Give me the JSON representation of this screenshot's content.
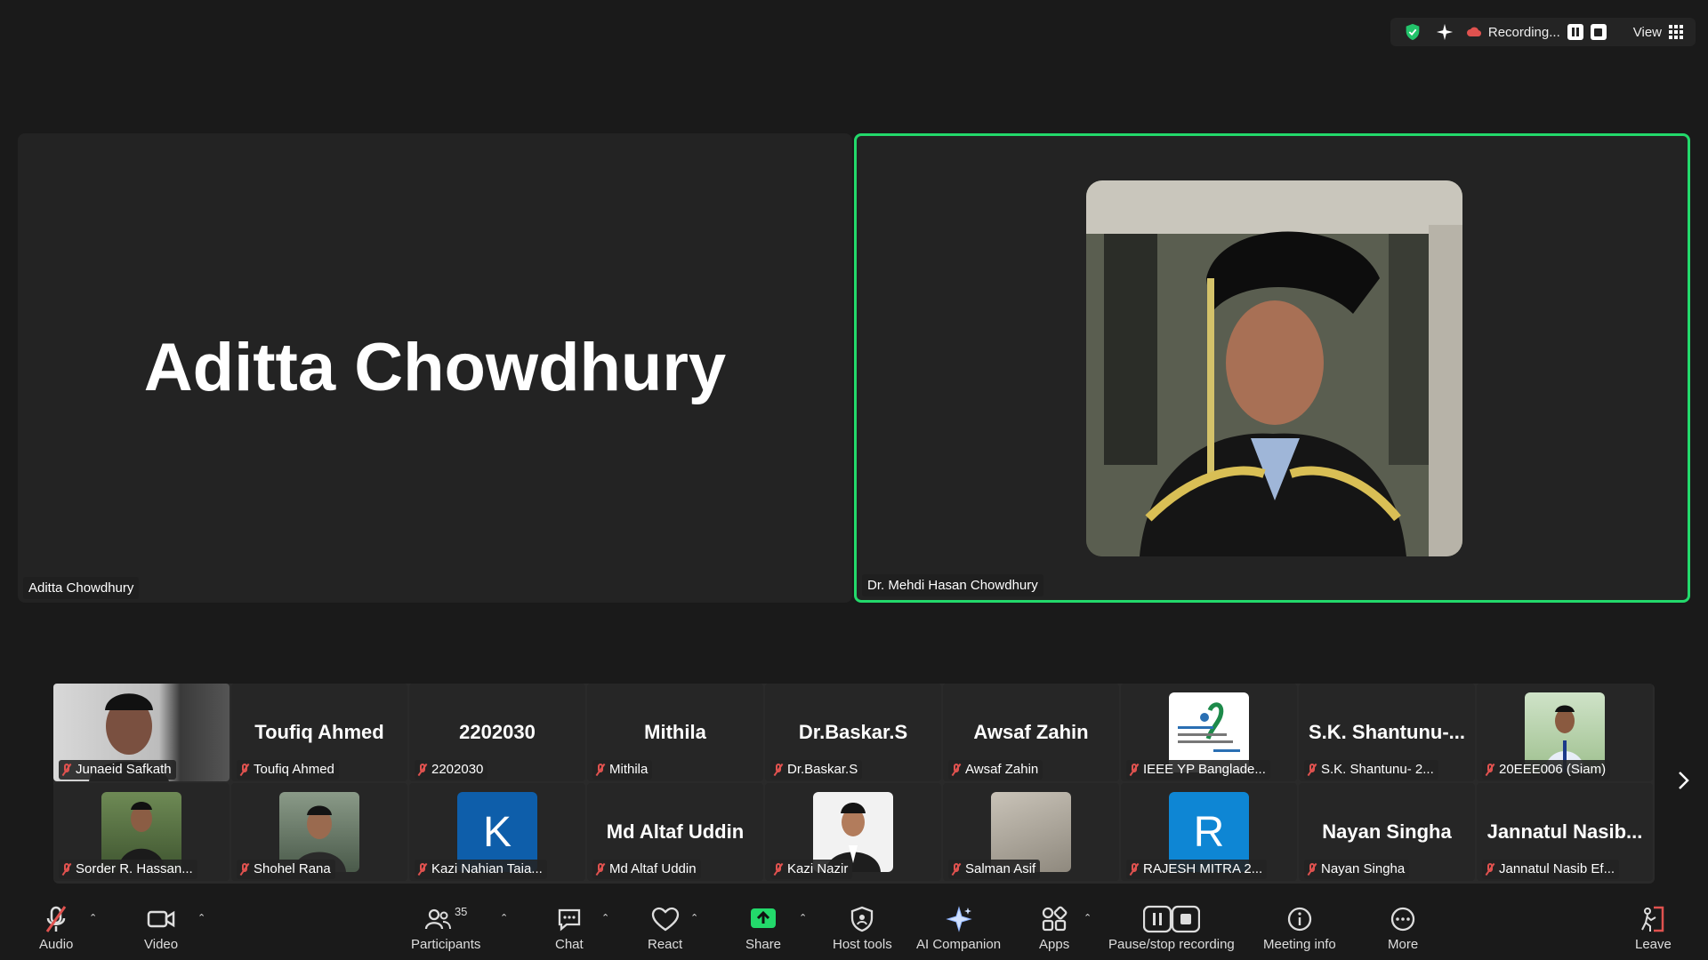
{
  "topbar": {
    "recording_label": "Recording...",
    "view_label": "View"
  },
  "main": {
    "left_tile": {
      "display_name": "Aditta Chowdhury",
      "tag": "Aditta Chowdhury"
    },
    "right_tile": {
      "tag": "Dr. Mehdi Hasan Chowdhury",
      "active_speaker_color": "#23d96b"
    }
  },
  "gallery": {
    "row1": [
      {
        "name": "Junaeid Safkath",
        "display": "",
        "kind": "video"
      },
      {
        "name": "Toufiq Ahmed",
        "display": "Toufiq Ahmed",
        "kind": "name"
      },
      {
        "name": "2202030",
        "display": "2202030",
        "kind": "name"
      },
      {
        "name": "Mithila",
        "display": "Mithila",
        "kind": "name"
      },
      {
        "name": "Dr.Baskar.S",
        "display": "Dr.Baskar.S",
        "kind": "name"
      },
      {
        "name": "Awsaf Zahin",
        "display": "Awsaf Zahin",
        "kind": "name"
      },
      {
        "name": "IEEE YP Banglade...",
        "display": "",
        "kind": "logo"
      },
      {
        "name": "S.K. Shantunu- 2...",
        "display": "S.K. Shantunu-...",
        "kind": "name"
      },
      {
        "name": "20EEE006 (Siam)",
        "display": "",
        "kind": "photo"
      }
    ],
    "row2": [
      {
        "name": "Sorder R. Hassan...",
        "display": "",
        "kind": "photo"
      },
      {
        "name": "Shohel Rana",
        "display": "",
        "kind": "photo"
      },
      {
        "name": "Kazi Nahian Taia...",
        "display": "K",
        "kind": "letter"
      },
      {
        "name": "Md Altaf Uddin",
        "display": "Md Altaf Uddin",
        "kind": "name"
      },
      {
        "name": "Kazi Nazir",
        "display": "",
        "kind": "photo"
      },
      {
        "name": "Salman Asif",
        "display": "",
        "kind": "photo"
      },
      {
        "name": "RAJESH MITRA 2...",
        "display": "R",
        "kind": "letter"
      },
      {
        "name": "Nayan Singha",
        "display": "Nayan Singha",
        "kind": "name"
      },
      {
        "name": "Jannatul Nasib Ef...",
        "display": "Jannatul  Nasib...",
        "kind": "name"
      }
    ]
  },
  "toolbar": {
    "audio": "Audio",
    "video": "Video",
    "participants": "Participants",
    "participants_count": "35",
    "chat": "Chat",
    "react": "React",
    "share": "Share",
    "host_tools": "Host tools",
    "ai_companion": "AI Companion",
    "apps": "Apps",
    "pause_stop_recording": "Pause/stop recording",
    "meeting_info": "Meeting info",
    "more": "More",
    "leave": "Leave"
  },
  "colors": {
    "share_green": "#23d96b",
    "mute_red": "#e0524f",
    "letter_blue": "#0e5eaa"
  }
}
